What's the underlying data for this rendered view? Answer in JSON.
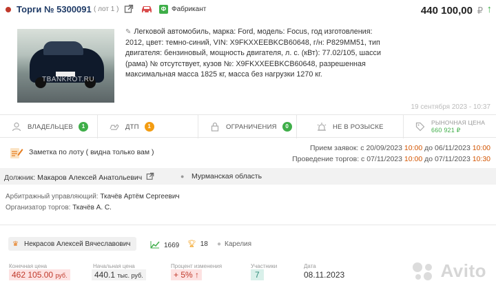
{
  "header": {
    "title": "Торги № 5300091",
    "lot_label": "( лот 1 )",
    "manufacturer_label": "Фабрикант",
    "price": "440 100,00",
    "currency": "₽",
    "price_trend_icon": "arrow-up-icon",
    "accent_color": "#3fae49"
  },
  "lot": {
    "photo_watermark": "TBANKROT.RU",
    "description": "Легковой автомобиль, марка: Ford, модель: Focus, год изготовления: 2012, цвет: темно-синий, VIN: X9FKXXEEBKCB60648, г/н: P829MM51, тип двигателя: бензиновый, мощность двигателя, л. с. (кВт): 77.02/105, шасси (рама) № отсутствует, кузов №: X9FKXXEEBKCB60648, разрешенная максимальная масса 1825 кг, масса без нагрузки 1270 кг.",
    "timestamp": "19 сентября 2023 - 10:37"
  },
  "stats": {
    "owners_label": "ВЛАДЕЛЬЦЕВ",
    "owners_count": "1",
    "dtp_label": "ДТП",
    "dtp_count": "1",
    "restrictions_label": "ОГРАНИЧЕНИЯ",
    "restrictions_count": "0",
    "wanted_label": "НЕ В РОЗЫСКЕ",
    "market_label": "РЫНОЧНАЯ ЦЕНА",
    "market_value": "660 921 ₽"
  },
  "note": {
    "text": "Заметка по лоту ( видна только вам )"
  },
  "dates": {
    "applications_label": "Прием заявок:",
    "applications_from_word": "с",
    "applications_from": "20/09/2023",
    "applications_from_time": "10:00",
    "applications_to_word": "до",
    "applications_to": "06/11/2023",
    "applications_to_time": "10:00",
    "trading_label": "Проведение торгов:",
    "trading_from_word": "с",
    "trading_from": "07/11/2023",
    "trading_from_time": "10:00",
    "trading_to_word": "до",
    "trading_to": "07/11/2023",
    "trading_to_time": "10:30"
  },
  "debtor": {
    "label": "Должник:",
    "name": "Макаров Алексей Анатольевич",
    "region": "Мурманская область"
  },
  "managers": {
    "arbitration_label": "Арбитражный управляющий:",
    "arbitration_name": "Ткачёв Артём Сергеевич",
    "organizer_label": "Организатор торгов:",
    "organizer_name": "Ткачёв А. С."
  },
  "result": {
    "winner": "Некрасов Алексей Вячеславович",
    "rating": "1669",
    "wins": "18",
    "winner_region": "Карелия",
    "final_price_label": "Конечная цена",
    "final_price": "462 105.00",
    "final_price_unit": "руб.",
    "start_price_label": "Начальная цена",
    "start_price": "440.1",
    "start_price_unit": "тыс. руб.",
    "change_label": "Процент изменения",
    "change_value": "+ 5%",
    "participants_label": "Участники",
    "participants": "7",
    "date_label": "Дата",
    "date": "08.11.2023"
  },
  "branding": {
    "watermark": "Avito"
  }
}
